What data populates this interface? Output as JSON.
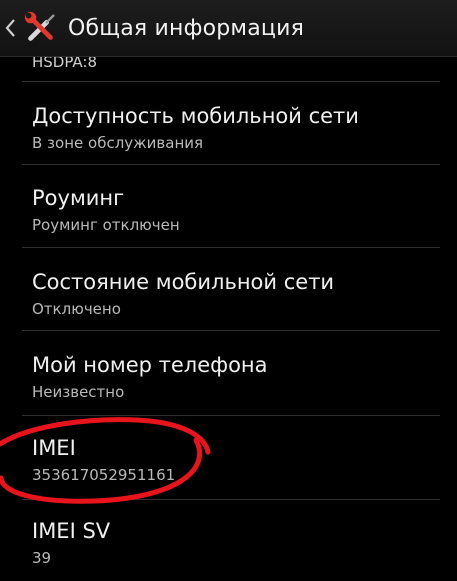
{
  "action_bar": {
    "title": "Общая информация",
    "icon": "tools-icon",
    "back_icon": "chevron-left-icon"
  },
  "list": {
    "partial_top": "HSDPA:8",
    "items": [
      {
        "label": "Доступность мобильной сети",
        "value": "В зоне обслуживания"
      },
      {
        "label": "Роуминг",
        "value": "Роуминг отключен"
      },
      {
        "label": "Состояние мобильной сети",
        "value": "Отключено"
      },
      {
        "label": "Мой номер телефона",
        "value": "Неизвестно"
      },
      {
        "label": "IMEI",
        "value": "353617052951161"
      },
      {
        "label": "IMEI SV",
        "value": "39"
      }
    ]
  },
  "colors": {
    "background": "#000000",
    "annotation_circle": "#e8141c"
  }
}
